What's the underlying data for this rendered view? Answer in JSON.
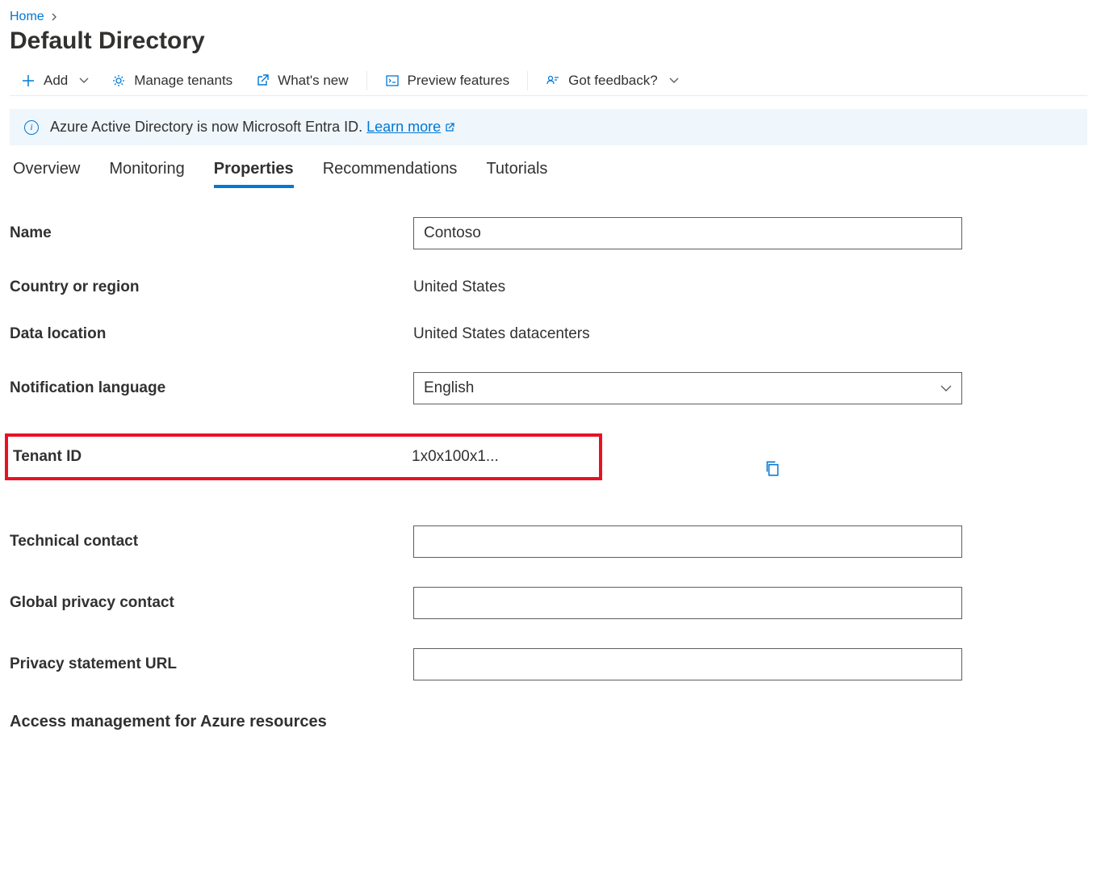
{
  "breadcrumb": {
    "home": "Home"
  },
  "pageTitle": "Default Directory",
  "toolbar": {
    "add": "Add",
    "manageTenants": "Manage tenants",
    "whatsNew": "What's new",
    "previewFeatures": "Preview features",
    "gotFeedback": "Got feedback?"
  },
  "banner": {
    "text": "Azure Active Directory is now Microsoft Entra ID. ",
    "linkText": "Learn more"
  },
  "tabs": {
    "overview": "Overview",
    "monitoring": "Monitoring",
    "properties": "Properties",
    "recommendations": "Recommendations",
    "tutorials": "Tutorials"
  },
  "form": {
    "name": {
      "label": "Name",
      "value": "Contoso"
    },
    "country": {
      "label": "Country or region",
      "value": "United States"
    },
    "dataLocation": {
      "label": "Data location",
      "value": "United States datacenters"
    },
    "notificationLanguage": {
      "label": "Notification language",
      "value": "English"
    },
    "tenantId": {
      "label": "Tenant ID",
      "value": "1x0x100x1..."
    },
    "technicalContact": {
      "label": "Technical contact",
      "value": ""
    },
    "globalPrivacyContact": {
      "label": "Global privacy contact",
      "value": ""
    },
    "privacyStatementUrl": {
      "label": "Privacy statement URL",
      "value": ""
    }
  },
  "sectionHeading": "Access management for Azure resources"
}
